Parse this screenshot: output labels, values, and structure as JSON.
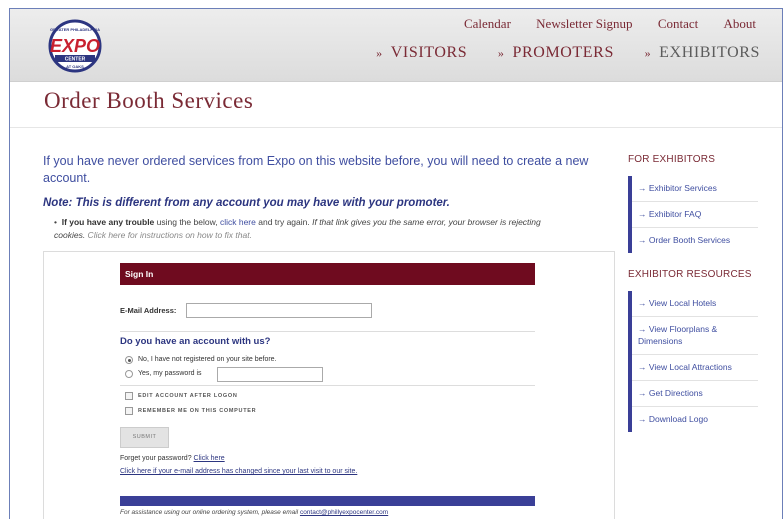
{
  "header": {
    "logo": {
      "top_text": "GREATER PHILADELPHIA",
      "main": "EXPO",
      "bottom_text": "CENTER",
      "ribbon": "AT OAKS",
      "color": "#c8202f",
      "ring_color": "#2c3580"
    },
    "top_nav": [
      "Calendar",
      "Newsletter Signup",
      "Contact",
      "About"
    ],
    "main_nav": [
      {
        "label": "VISITORS",
        "icon": "double-chevron-icon"
      },
      {
        "label": "PROMOTERS",
        "icon": "double-chevron-icon"
      },
      {
        "label": "EXHIBITORS",
        "icon": "double-chevron-icon"
      }
    ]
  },
  "page": {
    "title": "Order Booth Services",
    "intro": "If you have never ordered services from Expo on this website before, you will need to create a new account.",
    "note": "Note: This is different from any account you may have with your promoter.",
    "bullet": {
      "bold": "If you have any trouble",
      "t1": " using the below, ",
      "link1": "click here",
      "t2": " and try again. ",
      "italic": "If that link gives you the same error, your browser is rejecting cookies.",
      "link2": " Click here for instructions on how to fix that."
    }
  },
  "form": {
    "header": "Sign In",
    "email_label": "E-Mail Address:",
    "email_value": "",
    "question": "Do you have an account with us?",
    "option_new": "No, I have not registered on your site before.",
    "option_existing": "Yes, my password is",
    "password_value": "",
    "edit_account": "EDIT ACCOUNT AFTER LOGON",
    "remember": "REMEMBER ME ON THIS COMPUTER",
    "submit": "SUBMIT",
    "forgot_text": "Forget your password?",
    "forgot_link": "Click here",
    "changed_link": "Click here if your e-mail address has changed since your last visit to our site.",
    "assist_text": "For assistance using our online ordering system, please email",
    "assist_email": "contact@phillyexpocenter.com"
  },
  "sidebar": {
    "exhibitors_heading": "FOR EXHIBITORS",
    "exhibitors_items": [
      "Exhibitor Services",
      "Exhibitor FAQ",
      "Order Booth Services"
    ],
    "resources_heading": "EXHIBITOR RESOURCES",
    "resources_items": [
      "View Local Hotels",
      "View Floorplans & Dimensions",
      "View Local Attractions",
      "Get Directions",
      "Download Logo"
    ]
  },
  "colors": {
    "brand": "#7a2a35",
    "navy": "#3a3f97",
    "signin_bar": "#6f0b1f"
  }
}
